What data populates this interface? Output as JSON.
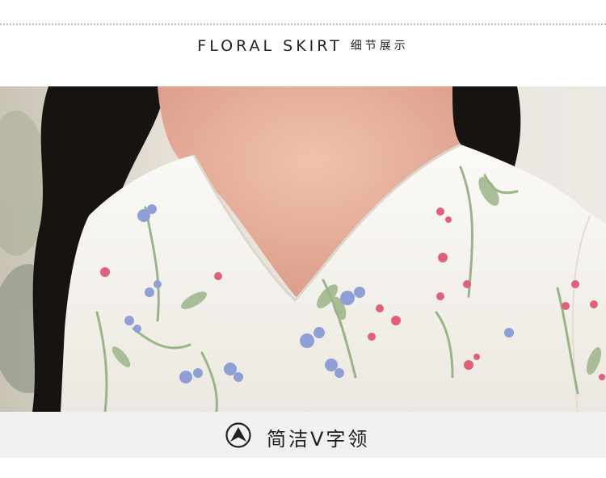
{
  "header": {
    "title_en": "FLORAL SKIRT",
    "title_cn": "细节展示"
  },
  "photo": {
    "subject": "woman-v-neck-floral-blouse-closeup",
    "colors": {
      "background": "#e9e3da",
      "hair": "#161210",
      "skin": "#e9b29e",
      "fabric": "#f6f3ee",
      "flower_pink": "#e0607a",
      "flower_blue": "#8e9fd6",
      "leaf": "#9bb487"
    }
  },
  "caption": {
    "icon": "circle-up-arrow-icon",
    "text": "简洁V字领"
  }
}
